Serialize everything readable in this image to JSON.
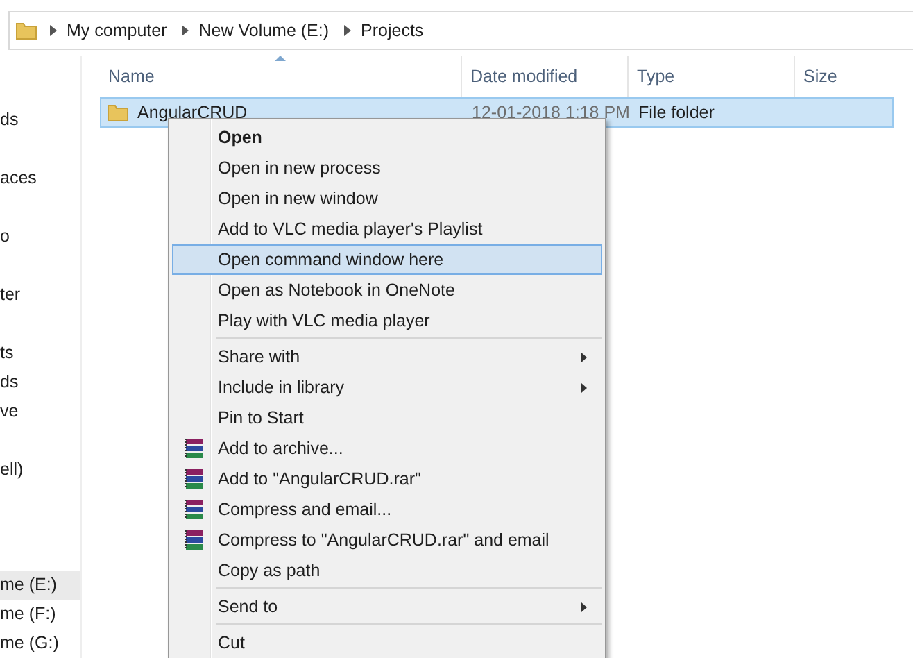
{
  "address_bar": {
    "crumbs": [
      "My computer",
      "New Volume (E:)",
      "Projects"
    ]
  },
  "sidebar": {
    "items": [
      {
        "label": "ds",
        "selected": false
      },
      {
        "label": "aces",
        "selected": false
      },
      {
        "label": "o",
        "selected": false
      },
      {
        "label": "ter",
        "selected": false
      },
      {
        "label": "ts",
        "selected": false
      },
      {
        "label": "ds",
        "selected": false
      },
      {
        "label": "ve",
        "selected": false
      },
      {
        "label": "ell)",
        "selected": false
      },
      {
        "label": "me (E:)",
        "selected": true
      },
      {
        "label": "me (F:)",
        "selected": false
      },
      {
        "label": "me (G:)",
        "selected": false
      }
    ]
  },
  "table": {
    "columns": [
      "Name",
      "Date modified",
      "Type",
      "Size"
    ],
    "rows": [
      {
        "name": "AngularCRUD",
        "date": "12-01-2018 1:18 PM",
        "type": "File folder",
        "selected": true
      }
    ]
  },
  "context_menu": {
    "items": [
      {
        "kind": "default",
        "label": "Open",
        "selected": false,
        "submenu": false
      },
      {
        "kind": "item",
        "label": "Open in new process",
        "selected": false,
        "submenu": false
      },
      {
        "kind": "item",
        "label": "Open in new window",
        "selected": false,
        "submenu": false
      },
      {
        "kind": "item",
        "label": "Add to VLC media player's Playlist",
        "selected": false,
        "submenu": false
      },
      {
        "kind": "item",
        "label": "Open command window here",
        "selected": true,
        "submenu": false
      },
      {
        "kind": "item",
        "label": "Open as Notebook in OneNote",
        "selected": false,
        "submenu": false
      },
      {
        "kind": "item",
        "label": "Play with VLC media player",
        "selected": false,
        "submenu": false
      },
      {
        "kind": "separator"
      },
      {
        "kind": "item",
        "label": "Share with",
        "selected": false,
        "submenu": true
      },
      {
        "kind": "item",
        "label": "Include in library",
        "selected": false,
        "submenu": true
      },
      {
        "kind": "item",
        "label": "Pin to Start",
        "selected": false,
        "submenu": false
      },
      {
        "kind": "archive",
        "label": "Add to archive...",
        "selected": false,
        "submenu": false
      },
      {
        "kind": "archive",
        "label": "Add to \"AngularCRUD.rar\"",
        "selected": false,
        "submenu": false
      },
      {
        "kind": "archive",
        "label": "Compress and email...",
        "selected": false,
        "submenu": false
      },
      {
        "kind": "archive",
        "label": "Compress to \"AngularCRUD.rar\" and email",
        "selected": false,
        "submenu": false
      },
      {
        "kind": "item",
        "label": "Copy as path",
        "selected": false,
        "submenu": false
      },
      {
        "kind": "separator"
      },
      {
        "kind": "item",
        "label": "Send to",
        "selected": false,
        "submenu": true
      },
      {
        "kind": "separator"
      },
      {
        "kind": "item",
        "label": "Cut",
        "selected": false,
        "submenu": false
      }
    ]
  }
}
